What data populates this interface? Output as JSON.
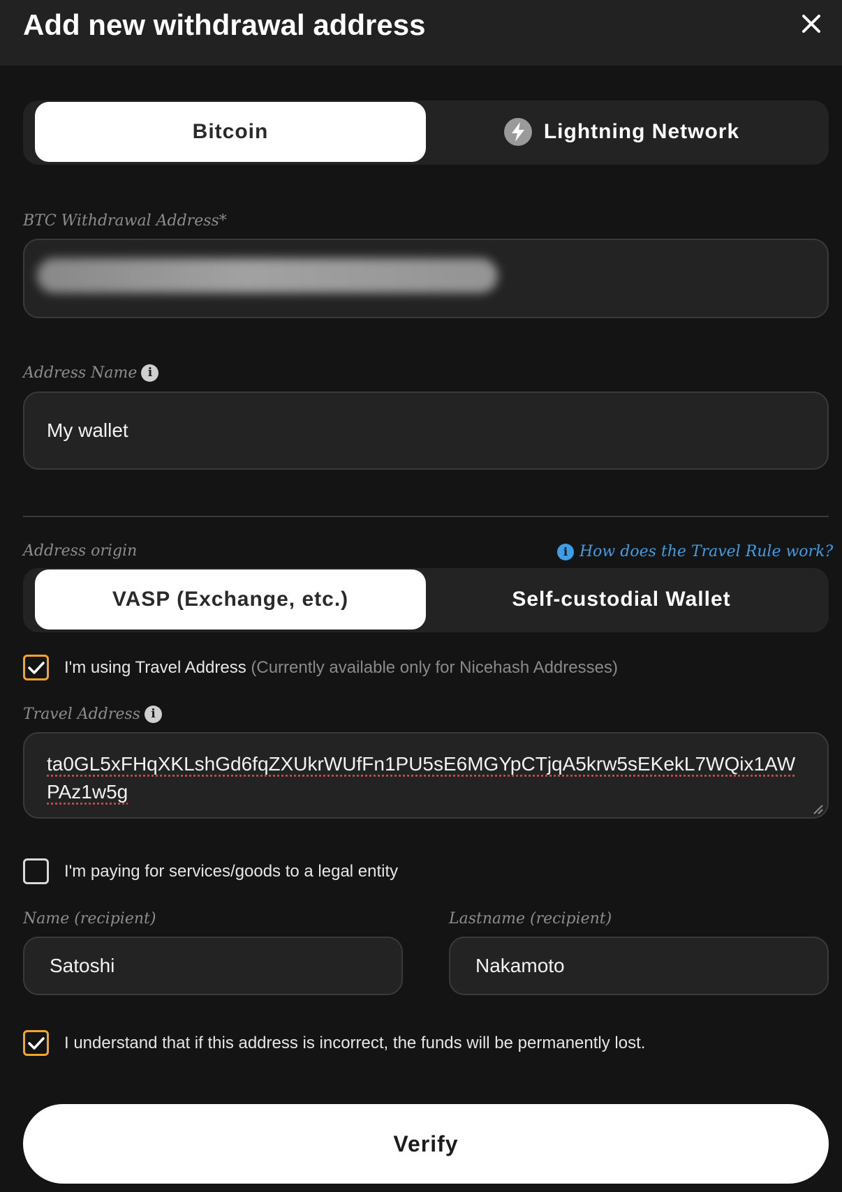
{
  "header": {
    "title": "Add new withdrawal address",
    "close_icon": "close-icon"
  },
  "network_toggle": {
    "options": [
      {
        "label": "Bitcoin",
        "selected": true
      },
      {
        "label": "Lightning Network",
        "selected": false,
        "icon": "lightning-icon"
      }
    ]
  },
  "btc_address": {
    "label": "BTC Withdrawal Address*",
    "value_redacted": true
  },
  "address_name": {
    "label": "Address Name",
    "value": "My wallet"
  },
  "address_origin": {
    "label": "Address origin",
    "help_link": "How does the Travel Rule work?",
    "options": [
      {
        "label": "VASP (Exchange, etc.)",
        "selected": true
      },
      {
        "label": "Self-custodial Wallet",
        "selected": false
      }
    ]
  },
  "travel_address_checkbox": {
    "checked": true,
    "label": "I'm using Travel Address",
    "note": "(Currently available only for Nicehash Addresses)"
  },
  "travel_address": {
    "label": "Travel Address",
    "value": "ta0GL5xFHqXKLshGd6fqZXUkrWUfFn1PU5sE6MGYpCTjqA5krw5sEKekL7WQix1AWPAz1w5g"
  },
  "legal_entity_checkbox": {
    "checked": false,
    "label": "I'm paying for services/goods to a legal entity"
  },
  "recipient": {
    "name_label": "Name (recipient)",
    "name_value": "Satoshi",
    "lastname_label": "Lastname (recipient)",
    "lastname_value": "Nakamoto"
  },
  "confirm_checkbox": {
    "checked": true,
    "label": "I understand that if this address is incorrect, the funds will be permanently lost."
  },
  "verify_button": {
    "label": "Verify"
  },
  "colors": {
    "background": "#141414",
    "header": "#222222",
    "field": "#232323",
    "accent_checkbox": "#f5a524",
    "link": "#3d9de6"
  }
}
